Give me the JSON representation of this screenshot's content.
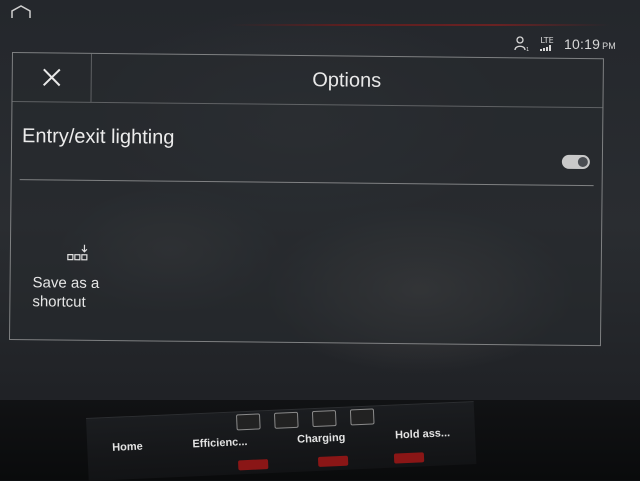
{
  "status_bar": {
    "lte_label": "LTE",
    "time": "10:19",
    "ampm": "PM",
    "icons": [
      "person-icon",
      "lte-signal-icon"
    ]
  },
  "dialog": {
    "title": "Options",
    "close_icon": "close-icon"
  },
  "option": {
    "label": "Entry/exit lighting",
    "toggle_state": "on"
  },
  "shortcut": {
    "label": "Save as a\nshortcut",
    "icon": "save-shortcut-icon"
  },
  "lower_panel": {
    "tabs": [
      "Home",
      "Efficienc...",
      "Charging",
      "Hold ass..."
    ]
  },
  "colors": {
    "text": "#ececec",
    "divider": "#c8c8c8",
    "toggle_track": "#c9c9c9",
    "accent_red": "#8a1616"
  }
}
